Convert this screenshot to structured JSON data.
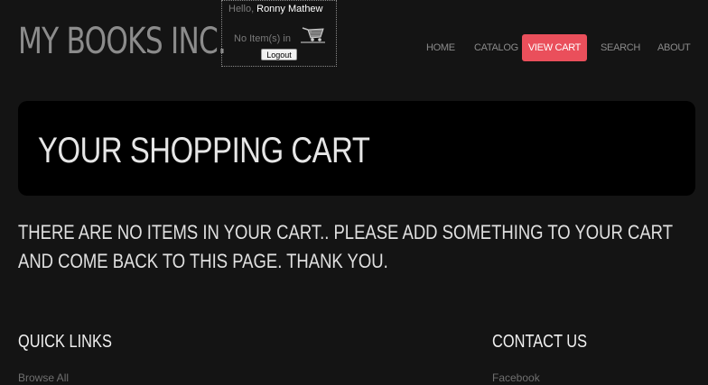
{
  "header": {
    "brand": "MY BOOKS INC.",
    "user_box": {
      "greeting": "Hello,",
      "username": "Ronny Mathew",
      "cart_status": "No Item(s) in",
      "cart_icon": "shopping-cart-icon",
      "logout_label": "Logout"
    }
  },
  "nav": {
    "items": [
      {
        "label": "HOME",
        "active": false
      },
      {
        "label": "CATALOG",
        "active": false
      },
      {
        "label": "VIEW CART",
        "active": true
      },
      {
        "label": "SEARCH",
        "active": false
      },
      {
        "label": "ABOUT",
        "active": false
      }
    ],
    "active_color": "#ea4f5b"
  },
  "main": {
    "title": "YOUR SHOPPING CART",
    "message": "THERE ARE NO ITEMS IN YOUR CART.. PLEASE ADD SOMETHING TO YOUR CART AND COME BACK TO THIS PAGE. THANK YOU."
  },
  "footer": {
    "quick_links": {
      "heading": "QUICK LINKS",
      "links": [
        "Browse All"
      ]
    },
    "contact": {
      "heading": "CONTACT US",
      "links": [
        "Facebook"
      ]
    }
  }
}
